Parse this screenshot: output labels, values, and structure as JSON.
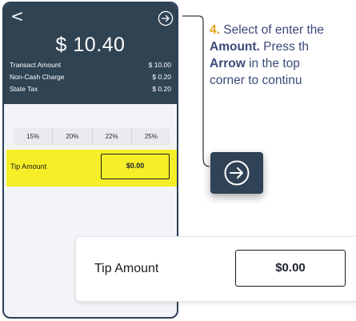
{
  "phone": {
    "back_glyph": "<",
    "total": "$ 10.40",
    "rows": [
      {
        "label": "Transact Amount",
        "value": "$ 10.00"
      },
      {
        "label": "Non-Cash Charge",
        "value": "$ 0.20"
      },
      {
        "label": "State Tax",
        "value": "$ 0.20"
      }
    ],
    "tip_percentages": [
      "15%",
      "20%",
      "22%",
      "25%"
    ],
    "tip_label": "Tip Amount",
    "tip_value": "$0.00"
  },
  "instruction": {
    "step_number": "4.",
    "line1": "Select of enter the",
    "line2_bold": "Amount.",
    "line2_rest": " Press th",
    "line3_bold": "Arrow",
    "line3_rest": " in the top",
    "line4": "corner to continu"
  },
  "zoom": {
    "tip_label": "Tip Amount",
    "tip_value": "$0.00"
  },
  "icons": [
    "back-arrow-icon",
    "next-arrow-circle-icon"
  ],
  "colors": {
    "header": "#2f4353",
    "highlight": "#f6ee27",
    "step_number": "#e3a21a",
    "instruction_text": "#3b4a7a"
  }
}
